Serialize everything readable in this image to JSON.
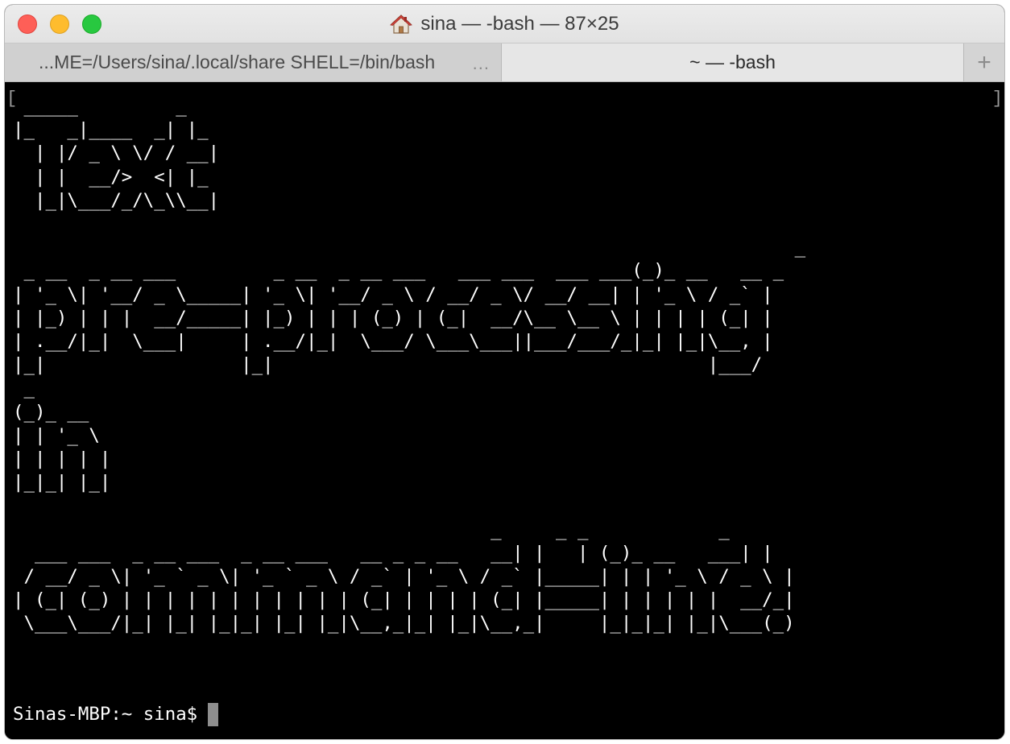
{
  "window": {
    "title": "sina — -bash — 87×25",
    "title_icon": "home-icon"
  },
  "tabs": [
    {
      "label": "...ME=/Users/sina/.local/share SHELL=/bin/bash",
      "more": "...",
      "active": false
    },
    {
      "label": "~ — -bash",
      "active": true
    }
  ],
  "new_tab_label": "+",
  "terminal": {
    "bracket_left": "[",
    "bracket_right": "]",
    "ascii_art": " _____         _\n|_   _|____  _| |_\n  | |/ _ \\ \\/ / __|\n  | |  __/>  <| |_\n  |_|\\___/_/\\_\\\\__|\n\n                                                                        _\n _ __  _ __ ___         _ __  _ __ ___   ___ ___  ___ ___(_)_ __   __ _\n| '_ \\| '__/ _ \\_____| '_ \\| '__/ _ \\ / __/ _ \\/ __/ __| | '_ \\ / _` |\n| |_) | | |  __/_____| |_) | | | (_) | (_|  __/\\__ \\__ \\ | | | | (_| |\n| .__/|_|  \\___|     | .__/|_|  \\___/ \\___\\___||___/___/_|_| |_|\\__, |\n|_|                  |_|                                        |___/\n _\n(_)_ __\n| | '_ \\\n| | | | |\n|_|_| |_|\n\n                                            _     _ _            _\n  ___ ___  _ __ ___  _ __ ___   __ _ _ __   __| |   | (_)_ __   ___| |\n / __/ _ \\| '_ ` _ \\| '_ ` _ \\ / _` | '_ \\ / _` |_____| | | '_ \\ / _ \\ |\n| (_| (_) | | | | | | | | | | | (_| | | | | (_| |_____| | | | | |  __/_|\n \\___\\___/|_| |_| |_|_| |_| |_|\\__,_|_| |_|\\__,_|     |_|_|_| |_|\\___(_)",
    "prompt": "Sinas-MBP:~ sina$"
  },
  "colors": {
    "terminal_bg": "#000000",
    "terminal_fg": "#ffffff",
    "cursor": "#8e8e8e",
    "close": "#fe5f57",
    "minimize": "#febc2e",
    "zoom": "#28c840"
  }
}
